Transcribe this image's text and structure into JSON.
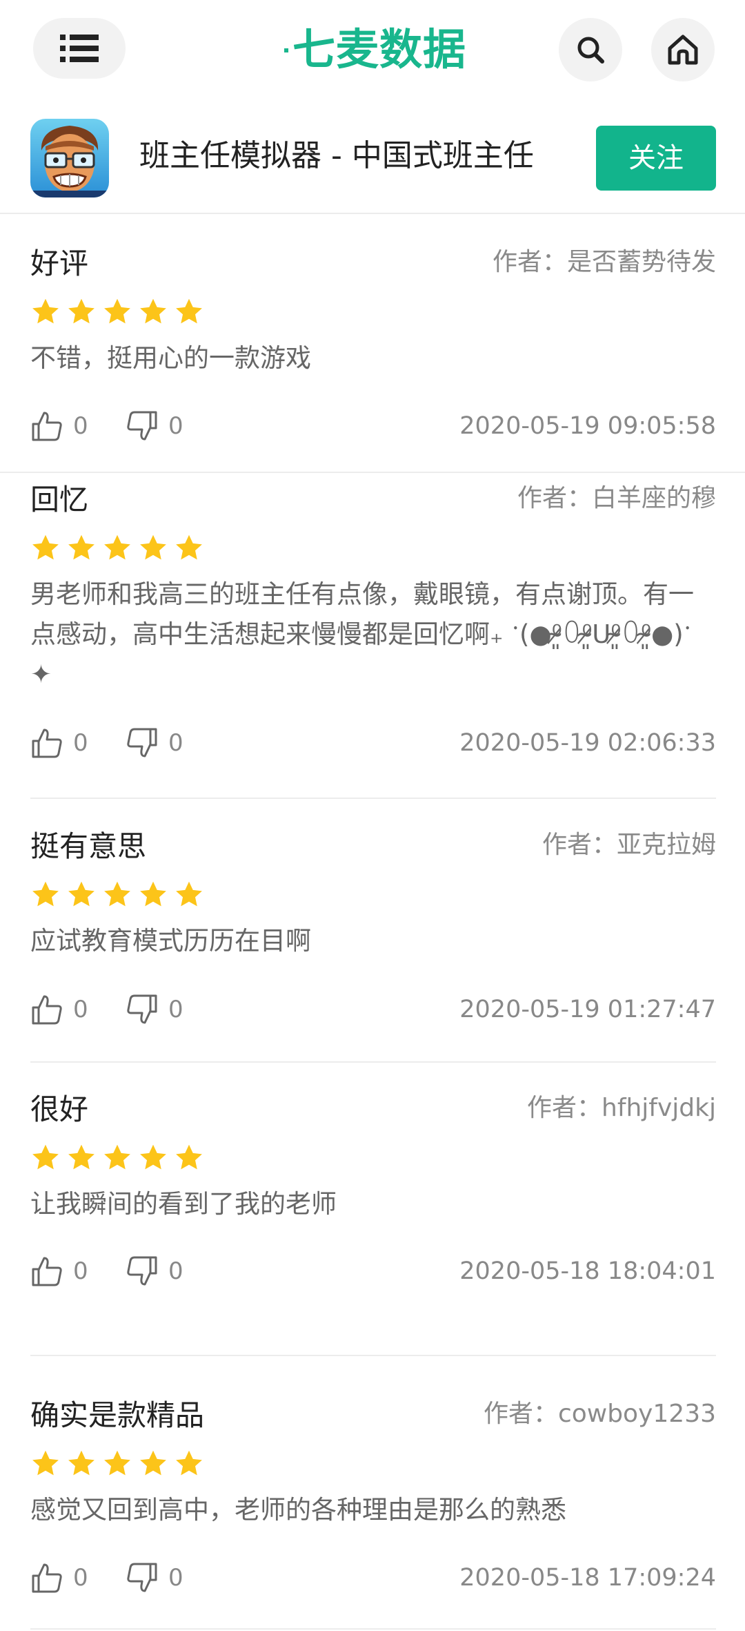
{
  "nav": {
    "brand": "七麦数据",
    "brand_color": "#19b68d",
    "menu_icon": "list-menu-icon",
    "search_icon": "search-icon",
    "home_icon": "home-icon"
  },
  "app": {
    "title": "班主任模拟器 - 中国式班主任",
    "follow_label": "关注",
    "accent_color": "#12b48c"
  },
  "reviews": [
    {
      "title": "好评",
      "author": "作者：是否蓄势待发",
      "rating": 5,
      "body": "不错，挺用心的一款游戏",
      "likes": "0",
      "dislikes": "0",
      "time": "2020-05-19 09:05:58"
    },
    {
      "title": "回忆",
      "author": "作者：白羊座的穆",
      "rating": 5,
      "body": "男老师和我高三的班主任有点像，戴眼镜，有点谢顶。有一点感动，高中生活想起来慢慢都是回忆啊₊ ॱ(●⁰̷̴͈꒨⁰̷̴͈ᑌ⁰̷̴͈꒨⁰̷̴͈●)ॱ ✦",
      "likes": "0",
      "dislikes": "0",
      "time": "2020-05-19 02:06:33"
    },
    {
      "title": "挺有意思",
      "author": "作者：亚克拉姆",
      "rating": 5,
      "body": "应试教育模式历历在目啊",
      "likes": "0",
      "dislikes": "0",
      "time": "2020-05-19 01:27:47"
    },
    {
      "title": "很好",
      "author": "作者：hfhjfvjdkj",
      "rating": 5,
      "body": "让我瞬间的看到了我的老师",
      "likes": "0",
      "dislikes": "0",
      "time": "2020-05-18 18:04:01"
    },
    {
      "title": "确实是款精品",
      "author": "作者：cowboy1233",
      "rating": 5,
      "body": "感觉又回到高中，老师的各种理由是那么的熟悉",
      "likes": "0",
      "dislikes": "0",
      "time": "2020-05-18 17:09:24"
    }
  ]
}
